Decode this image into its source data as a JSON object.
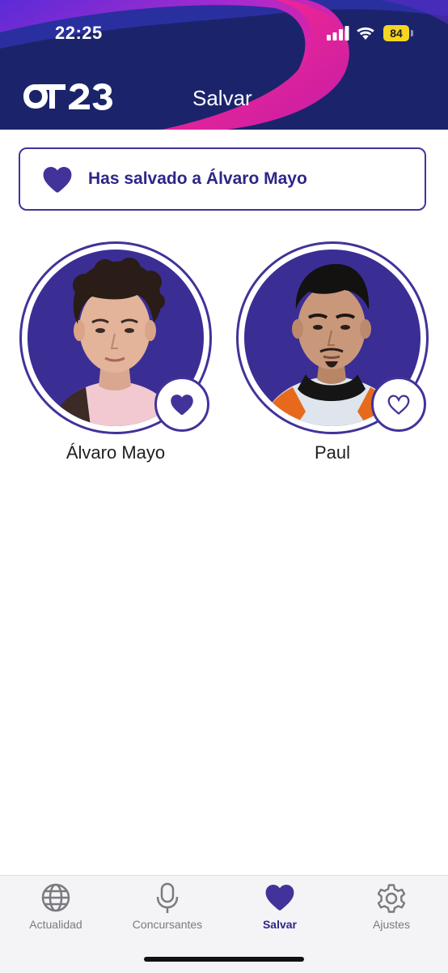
{
  "status_bar": {
    "time": "22:25",
    "battery_level": "84",
    "signal_icon": "cellular-signal-icon",
    "wifi_icon": "wifi-icon"
  },
  "header": {
    "logo": "OT23",
    "title": "Salvar"
  },
  "saved_banner": {
    "icon": "heart-filled-icon",
    "message": "Has salvado a Álvaro Mayo"
  },
  "contestants": [
    {
      "name": "Álvaro Mayo",
      "saved": true,
      "icon": "heart-filled-icon"
    },
    {
      "name": "Paul",
      "saved": false,
      "icon": "heart-outline-icon"
    }
  ],
  "tabs": [
    {
      "label": "Actualidad",
      "icon": "globe-icon",
      "active": false
    },
    {
      "label": "Concursantes",
      "icon": "microphone-icon",
      "active": false
    },
    {
      "label": "Salvar",
      "icon": "heart-icon",
      "active": true
    },
    {
      "label": "Ajustes",
      "icon": "gear-icon",
      "active": false
    }
  ],
  "colors": {
    "brand_purple": "#41339a",
    "header_navy": "#1b246b",
    "header_magenta": "#e0158f",
    "battery_yellow": "#f5d524"
  }
}
